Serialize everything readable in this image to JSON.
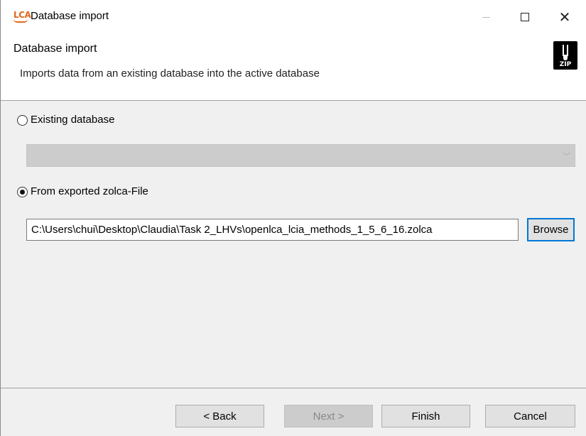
{
  "window": {
    "title": "Database import",
    "minimize_label": "",
    "maximize_label": "",
    "close_label": "✕"
  },
  "header": {
    "title": "Database import",
    "description": "Imports data from an existing database into the active database",
    "icon_label": "ZIP"
  },
  "options": {
    "existing_database_label": "Existing database",
    "existing_database_selected": false,
    "existing_database_value": "",
    "exported_file_label": "From exported zolca-File",
    "exported_file_selected": true
  },
  "file": {
    "path": "C:\\Users\\chui\\Desktop\\Claudia\\Task 2_LHVs\\openlca_lcia_methods_1_5_6_16.zolca",
    "browse_label": "Browse"
  },
  "footer": {
    "back_label": "< Back",
    "next_label": "Next >",
    "finish_label": "Finish",
    "cancel_label": "Cancel"
  },
  "colors": {
    "accent": "#0078d7",
    "app_icon": "#e06a1a"
  },
  "icons": {
    "app": "lca-app-icon",
    "header": "zip-file-icon"
  }
}
